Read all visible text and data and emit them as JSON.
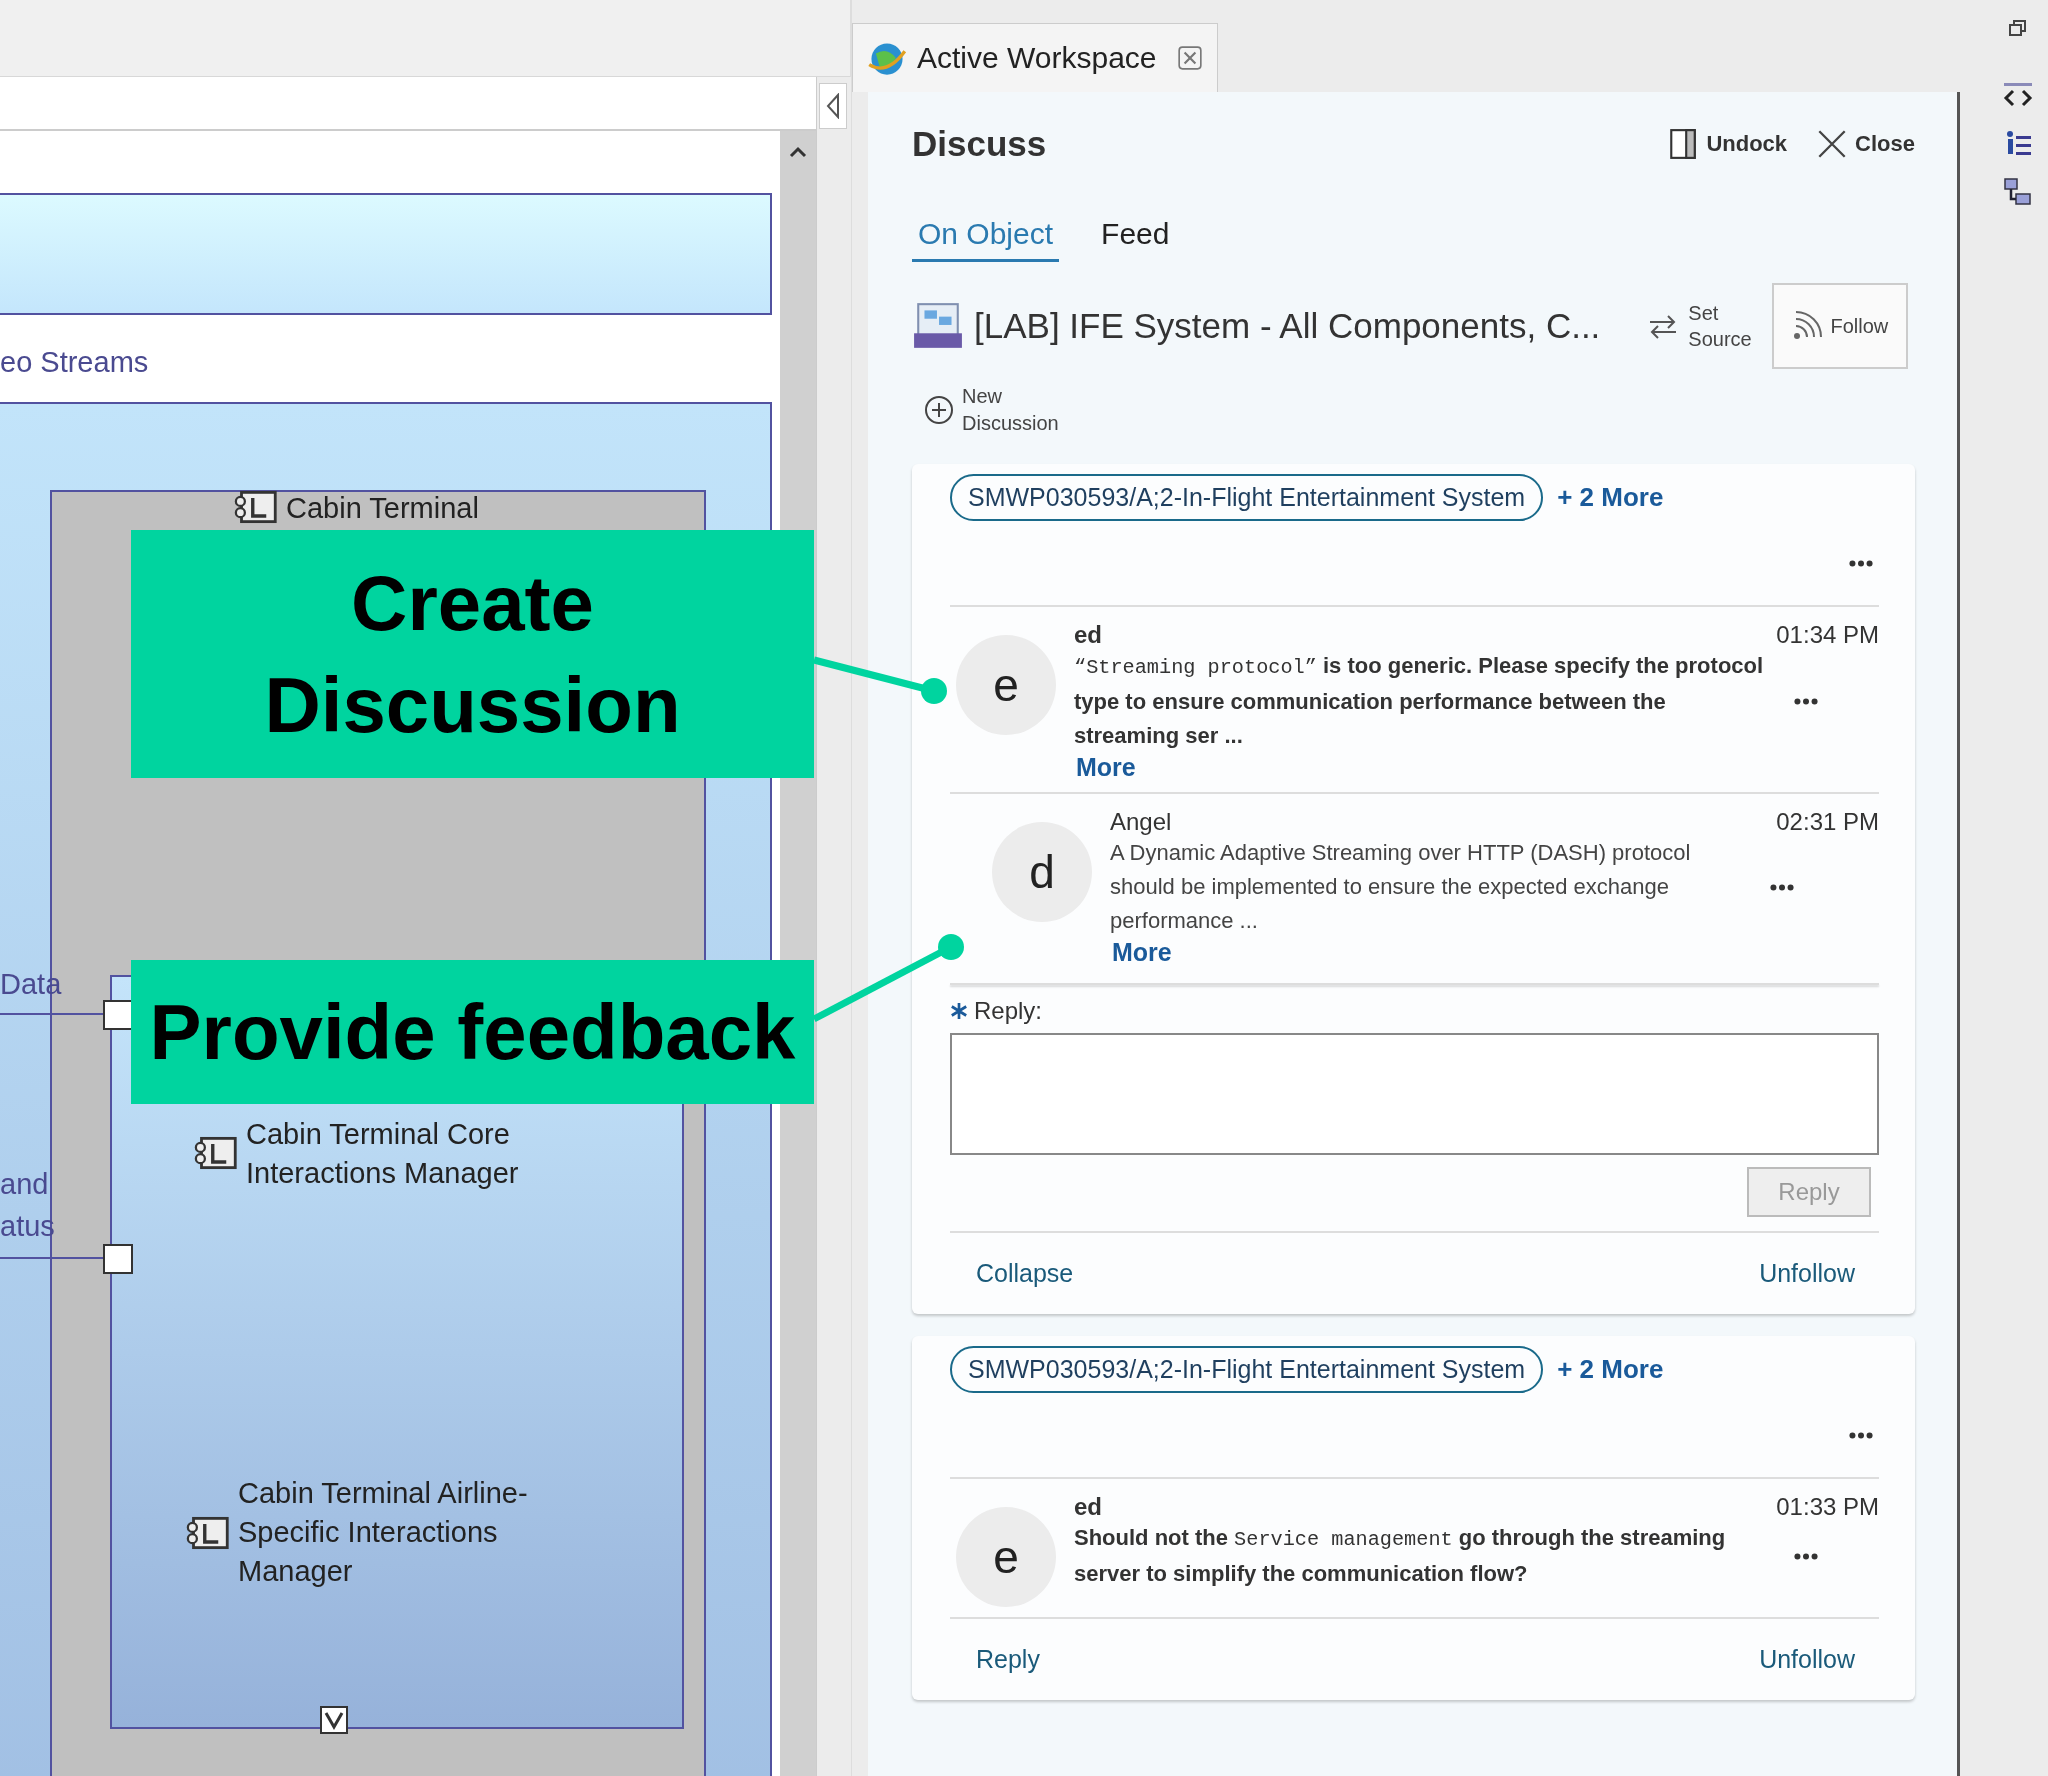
{
  "diagram": {
    "fragments": [
      "eo Streams",
      "Data",
      "and",
      "atus"
    ],
    "components": [
      {
        "label": "Cabin Terminal"
      },
      {
        "label": "Cabin Terminal Core Interactions Manager"
      },
      {
        "label": "Cabin Terminal Airline-Specific Interactions Manager"
      }
    ]
  },
  "callouts": [
    {
      "text": "Create Discussion"
    },
    {
      "text": "Provide feedback"
    }
  ],
  "workspace_tab": {
    "title": "Active Workspace"
  },
  "panel": {
    "title": "Discuss",
    "actions": [
      {
        "kind": "undock",
        "label": "Undock"
      },
      {
        "kind": "close",
        "label": "Close"
      }
    ],
    "tabs": [
      {
        "label": "On Object",
        "selected": true
      },
      {
        "label": "Feed",
        "selected": false
      }
    ],
    "object_title": "[LAB] IFE System - All Components, C...",
    "set_source": "Set Source",
    "follow": "Follow",
    "new_discussion": "New Discussion"
  },
  "discussions": [
    {
      "tag": "SMWP030593/A;2-In-Flight Entertainment System",
      "more_tags": "+ 2 More",
      "comments": [
        {
          "avatar": "e",
          "author": "ed",
          "time": "01:34 PM",
          "unread": true,
          "parts": [
            {
              "kind": "code",
              "text": "“Streaming protocol”"
            },
            {
              "kind": "plain",
              "text": " is too generic. Please specify the protocol type to ensure communication performance between the streaming ser ..."
            }
          ],
          "more": "More",
          "children": [
            {
              "avatar": "d",
              "author": "Angel",
              "time": "02:31 PM",
              "unread": false,
              "parts": [
                {
                  "kind": "plain",
                  "text": "A Dynamic Adaptive Streaming over HTTP (DASH) protocol should be  implemented to ensure the expected exchange performance ..."
                }
              ],
              "more": "More"
            }
          ]
        }
      ],
      "reply_form": {
        "label": "Reply:",
        "button": "Reply",
        "disabled": true
      },
      "footer": [
        "Collapse",
        "Unfollow"
      ]
    },
    {
      "tag": "SMWP030593/A;2-In-Flight Entertainment System",
      "more_tags": "+ 2 More",
      "comments": [
        {
          "avatar": "e",
          "author": "ed",
          "time": "01:33 PM",
          "unread": true,
          "parts": [
            {
              "kind": "plain",
              "text": "Should not the "
            },
            {
              "kind": "code",
              "text": "Service management"
            },
            {
              "kind": "plain",
              "text": " go through the streaming server to simplify the communication flow?"
            }
          ]
        }
      ],
      "footer": [
        "Reply",
        "Unfollow"
      ]
    }
  ]
}
